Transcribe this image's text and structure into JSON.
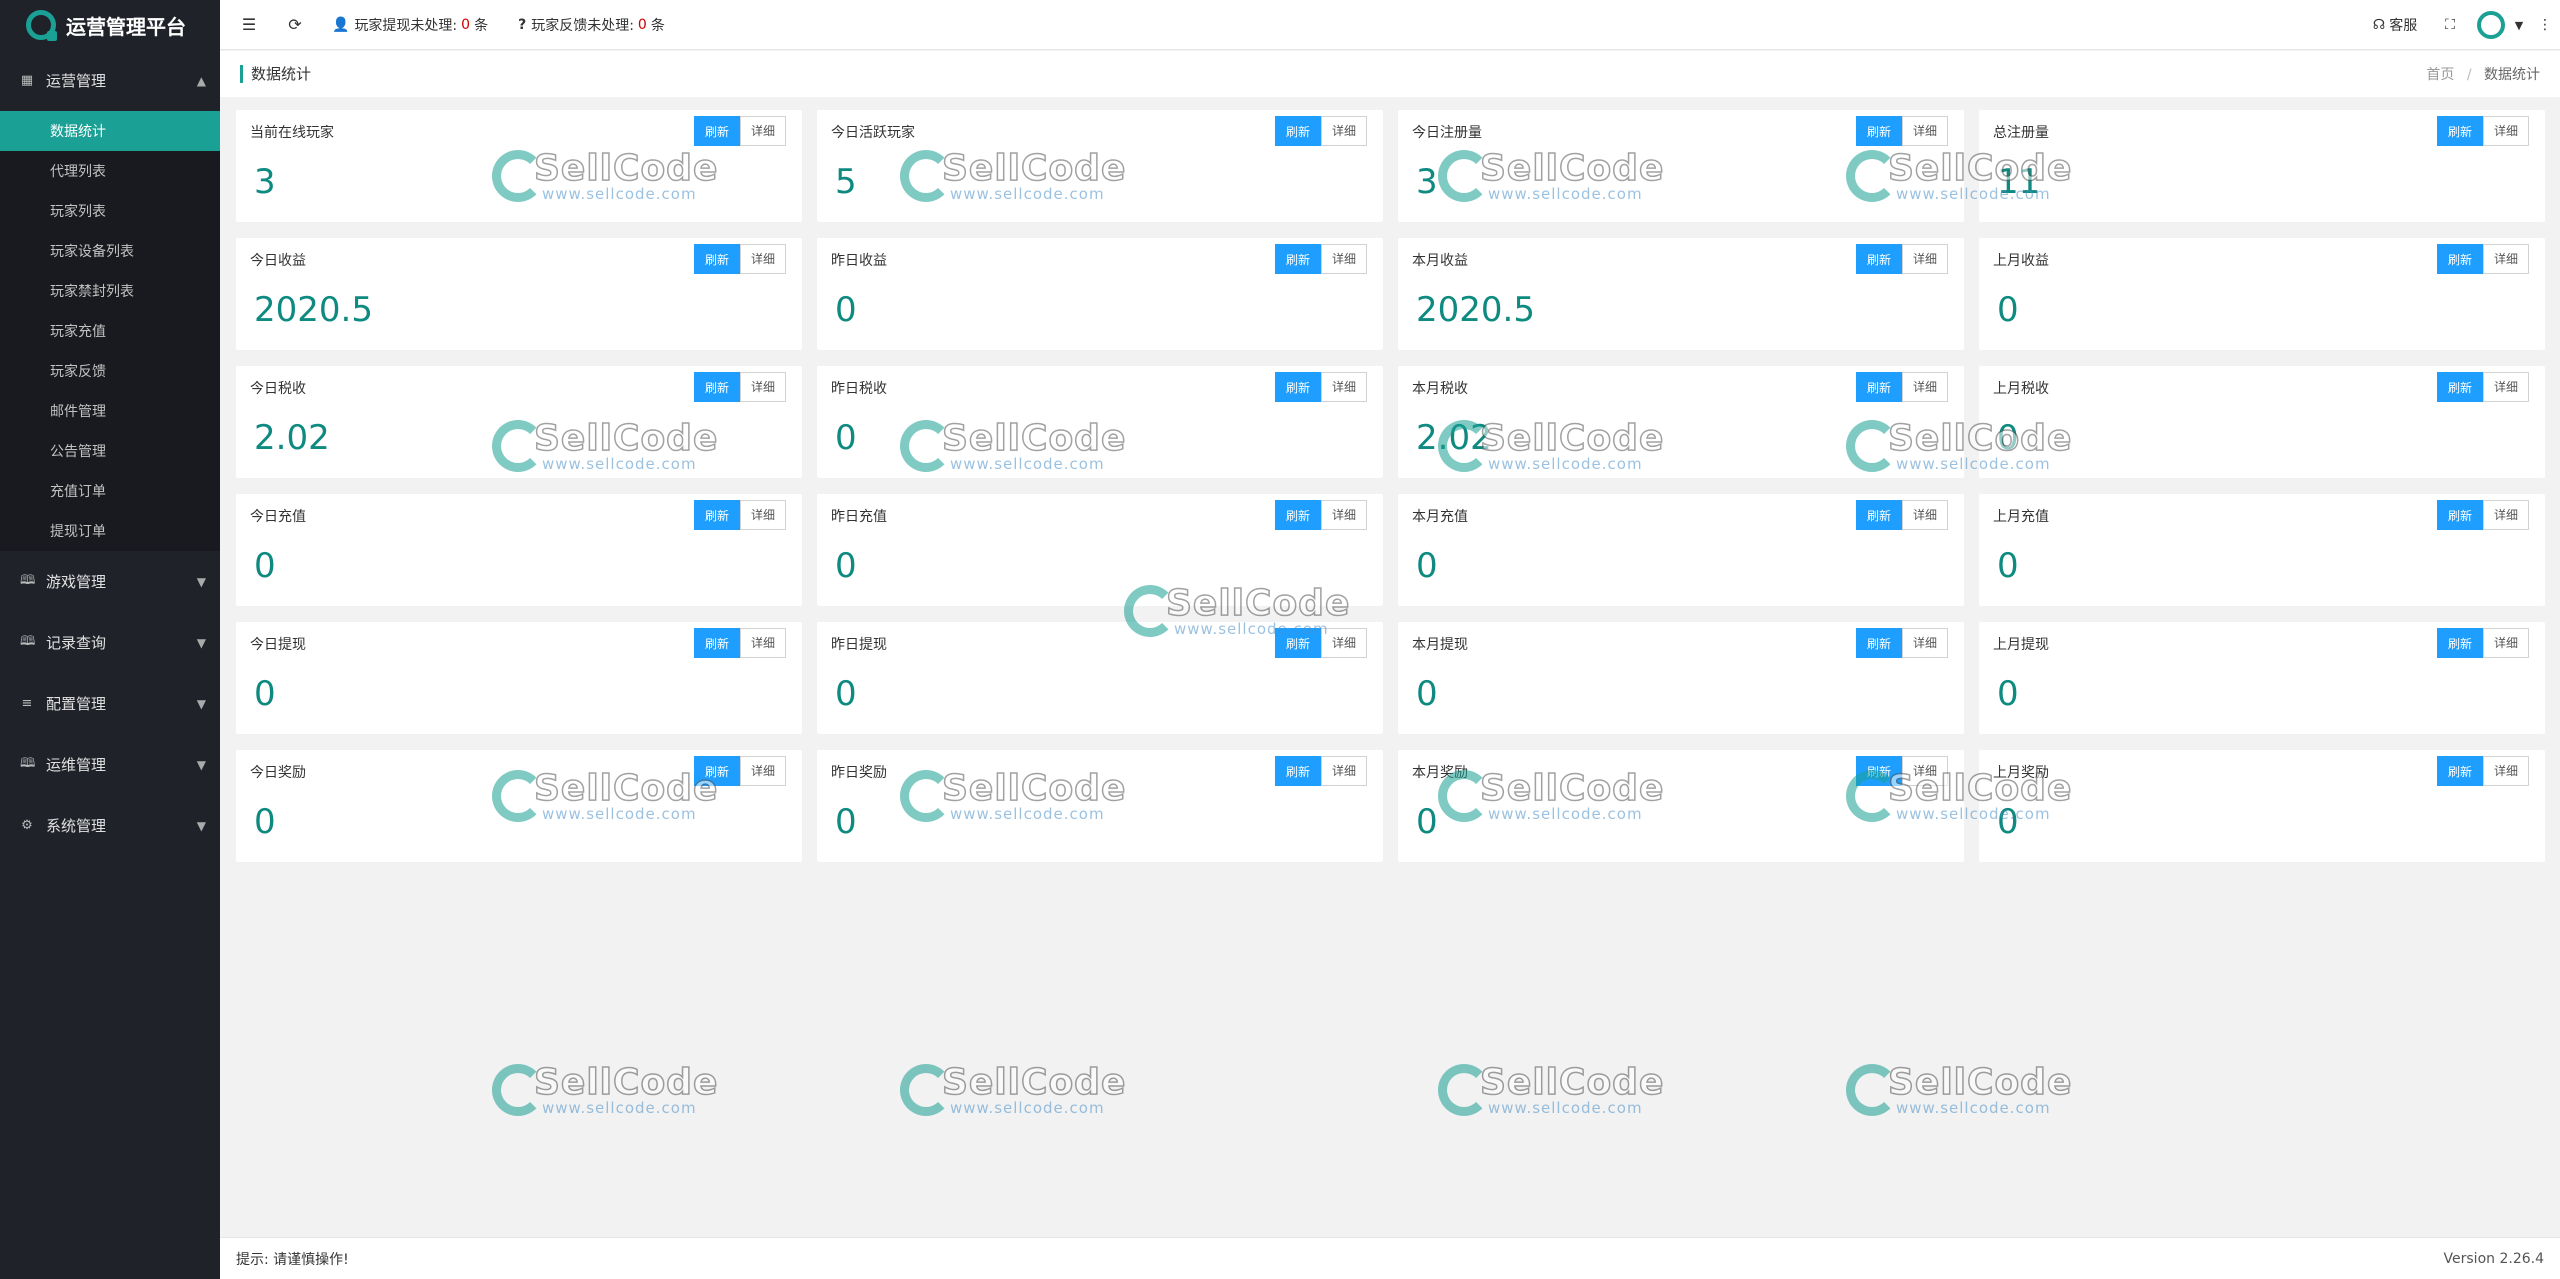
{
  "app": {
    "title": "运营管理平台"
  },
  "sidebar": {
    "groups": [
      {
        "label": "运营管理",
        "expanded": true,
        "icon": "dashboard-icon",
        "items": [
          "数据统计",
          "代理列表",
          "玩家列表",
          "玩家设备列表",
          "玩家禁封列表",
          "玩家充值",
          "玩家反馈",
          "邮件管理",
          "公告管理",
          "充值订单",
          "提现订单"
        ]
      },
      {
        "label": "游戏管理",
        "expanded": false,
        "icon": "book-icon"
      },
      {
        "label": "记录查询",
        "expanded": false,
        "icon": "book-icon"
      },
      {
        "label": "配置管理",
        "expanded": false,
        "icon": "list-icon"
      },
      {
        "label": "运维管理",
        "expanded": false,
        "icon": "book-icon"
      },
      {
        "label": "系统管理",
        "expanded": false,
        "icon": "gear-icon"
      }
    ],
    "active_item": "数据统计"
  },
  "header": {
    "withdraw_note": {
      "prefix": "玩家提现未处理:",
      "count": "0",
      "suffix": "条"
    },
    "feedback_note": {
      "prefix": "玩家反馈未处理:",
      "count": "0",
      "suffix": "条"
    },
    "service_label": "客服"
  },
  "titlebar": {
    "title": "数据统计",
    "crumb_home": "首页",
    "crumb_sep": "/",
    "crumb_current": "数据统计"
  },
  "buttons": {
    "refresh": "刷新",
    "detail": "详细"
  },
  "cards": [
    {
      "label": "当前在线玩家",
      "value": "3"
    },
    {
      "label": "今日活跃玩家",
      "value": "5"
    },
    {
      "label": "今日注册量",
      "value": "3"
    },
    {
      "label": "总注册量",
      "value": "11"
    },
    {
      "label": "今日收益",
      "value": "2020.5"
    },
    {
      "label": "昨日收益",
      "value": "0"
    },
    {
      "label": "本月收益",
      "value": "2020.5"
    },
    {
      "label": "上月收益",
      "value": "0"
    },
    {
      "label": "今日税收",
      "value": "2.02"
    },
    {
      "label": "昨日税收",
      "value": "0"
    },
    {
      "label": "本月税收",
      "value": "2.02"
    },
    {
      "label": "上月税收",
      "value": "0"
    },
    {
      "label": "今日充值",
      "value": "0"
    },
    {
      "label": "昨日充值",
      "value": "0"
    },
    {
      "label": "本月充值",
      "value": "0"
    },
    {
      "label": "上月充值",
      "value": "0"
    },
    {
      "label": "今日提现",
      "value": "0"
    },
    {
      "label": "昨日提现",
      "value": "0"
    },
    {
      "label": "本月提现",
      "value": "0"
    },
    {
      "label": "上月提现",
      "value": "0"
    },
    {
      "label": "今日奖励",
      "value": "0"
    },
    {
      "label": "昨日奖励",
      "value": "0"
    },
    {
      "label": "本月奖励",
      "value": "0"
    },
    {
      "label": "上月奖励",
      "value": "0"
    }
  ],
  "watermark": {
    "brand": "SellCode",
    "url": "www.sellcode.com"
  },
  "footer": {
    "tip": "提示: 请谨慎操作!",
    "version": "Version 2.26.4"
  },
  "colors": {
    "accent": "#1aa094",
    "sidebar_bg": "#20222a",
    "refresh_btn": "#1e9fff",
    "value_text": "#0e8a80",
    "alert_count": "#cc0000"
  }
}
